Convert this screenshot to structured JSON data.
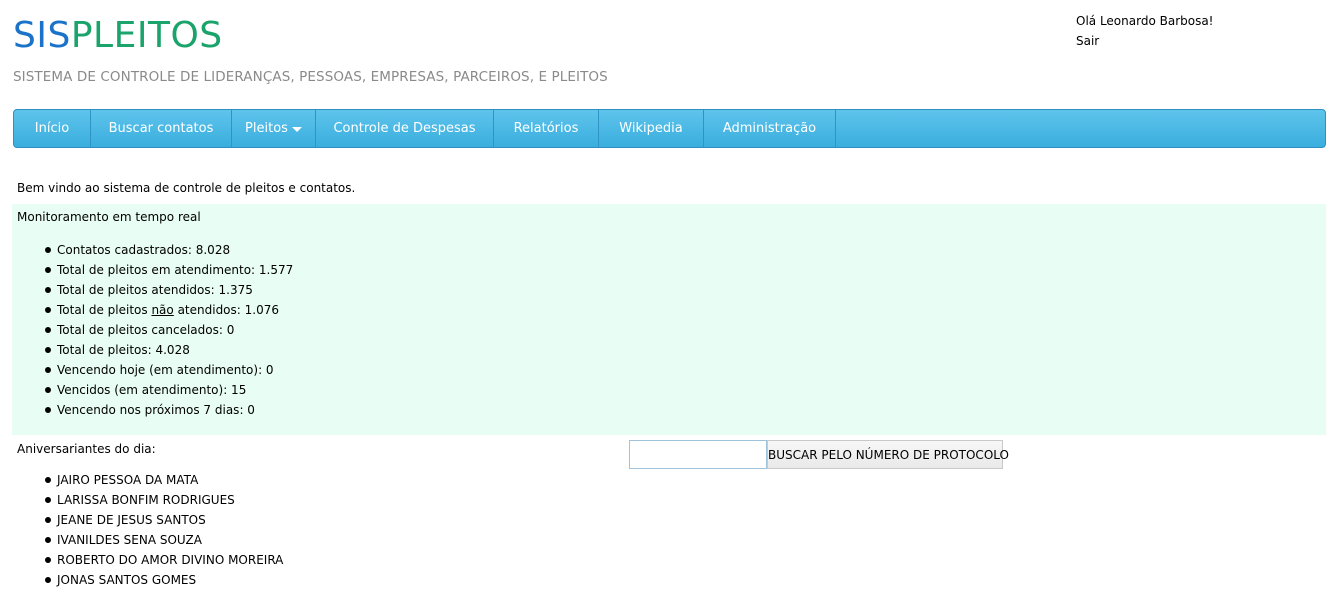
{
  "header": {
    "logo_part1": "SIS",
    "logo_part2": "PLEITOS",
    "subtitle": "SISTEMA DE CONTROLE DE LIDERANÇAS, PESSOAS, EMPRESAS, PARCEIROS, E PLEITOS",
    "greeting": "Olá Leonardo Barbosa!",
    "logout": "Sair"
  },
  "nav": {
    "items": [
      {
        "label": "Início"
      },
      {
        "label": "Buscar contatos"
      },
      {
        "label": "Pleitos"
      },
      {
        "label": "Controle de Despesas"
      },
      {
        "label": "Relatórios"
      },
      {
        "label": "Wikipedia"
      },
      {
        "label": "Administração"
      }
    ]
  },
  "main": {
    "welcome": "Bem vindo ao sistema de controle de pleitos e contatos.",
    "monitor_title": "Monitoramento em tempo real",
    "stats": [
      "Contatos cadastrados: 8.028",
      "Total de pleitos em atendimento: 1.577",
      "Total de pleitos atendidos: 1.375",
      {
        "before": "Total de pleitos ",
        "underlined": "não",
        "after": " atendidos: 1.076"
      },
      "Total de pleitos cancelados: 0",
      "Total de pleitos: 4.028",
      "Vencendo hoje (em atendimento): 0",
      "Vencidos (em atendimento): 15",
      "Vencendo nos próximos 7 dias: 0"
    ],
    "birthday_title": "Aniversariantes do dia:",
    "birthdays": [
      "JAIRO PESSOA DA MATA",
      "LARISSA BONFIM RODRIGUES",
      "JEANE DE JESUS SANTOS",
      "IVANILDES SENA SOUZA",
      "ROBERTO DO AMOR DIVINO MOREIRA",
      "JONAS SANTOS GOMES"
    ],
    "protocol_search": {
      "value": "",
      "button_label": "BUSCAR PELO NÚMERO DE PROTOCOLO"
    }
  },
  "colors": {
    "logo_blue": "#1a73c9",
    "logo_green": "#1aa36a",
    "nav_background": "#4bb9e6",
    "monitor_background": "#e8fdf4"
  }
}
